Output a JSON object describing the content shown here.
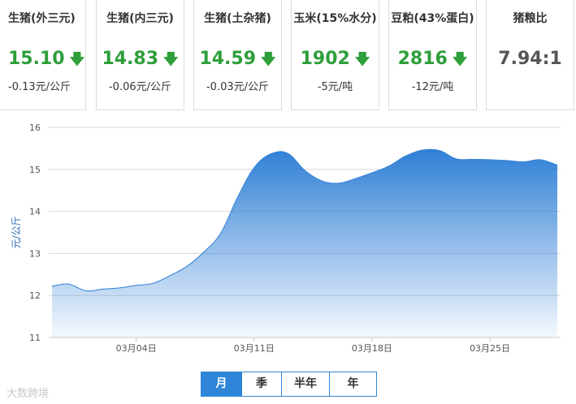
{
  "cards": [
    {
      "name": "生猪(外三元)",
      "price": "15.10",
      "change": "-0.13元/公斤",
      "arrow": "🡇"
    },
    {
      "name": "生猪(内三元)",
      "price": "14.83",
      "change": "-0.06元/公斤",
      "arrow": "🡇"
    },
    {
      "name": "生猪(土杂猪)",
      "price": "14.59",
      "change": "-0.03元/公斤",
      "arrow": "🡇"
    },
    {
      "name": "玉米(15%水分)",
      "price": "1902",
      "change": "-5元/吨",
      "arrow": "🡇"
    },
    {
      "name": "豆粕(43%蛋白)",
      "price": "2816",
      "change": "-12元/吨",
      "arrow": "🡇"
    },
    {
      "name": "猪粮比",
      "price": "7.94:1",
      "change": "",
      "arrow": ""
    }
  ],
  "tabs": [
    {
      "label": "月",
      "active": true
    },
    {
      "label": "季",
      "active": false
    },
    {
      "label": "半年",
      "active": false
    },
    {
      "label": "年",
      "active": false
    }
  ],
  "watermark": "大数跨境",
  "colors": {
    "accent": "#2f86d9",
    "down": "#2e9f3a"
  },
  "chart_data": {
    "type": "area",
    "title": "",
    "xlabel": "",
    "ylabel": "元/公斤",
    "ylim": [
      11,
      16
    ],
    "yticks": [
      11,
      12,
      13,
      14,
      15,
      16
    ],
    "xtick_labels": [
      "03月04日",
      "03月11日",
      "03月18日",
      "03月25日"
    ],
    "xtick_positions": [
      6,
      13,
      20,
      27
    ],
    "grid": true,
    "x": [
      1,
      2,
      3,
      4,
      5,
      6,
      7,
      8,
      9,
      10,
      11,
      12,
      13,
      14,
      15,
      16,
      17,
      18,
      19,
      20,
      21,
      22,
      23,
      24,
      25,
      26,
      27,
      28,
      29,
      30,
      31
    ],
    "values": [
      12.22,
      12.27,
      12.11,
      12.15,
      12.18,
      12.24,
      12.29,
      12.47,
      12.69,
      13.03,
      13.47,
      14.32,
      15.04,
      15.37,
      15.38,
      14.98,
      14.73,
      14.67,
      14.78,
      14.92,
      15.08,
      15.32,
      15.46,
      15.45,
      15.25,
      15.24,
      15.23,
      15.21,
      15.18,
      15.23,
      15.1
    ]
  }
}
